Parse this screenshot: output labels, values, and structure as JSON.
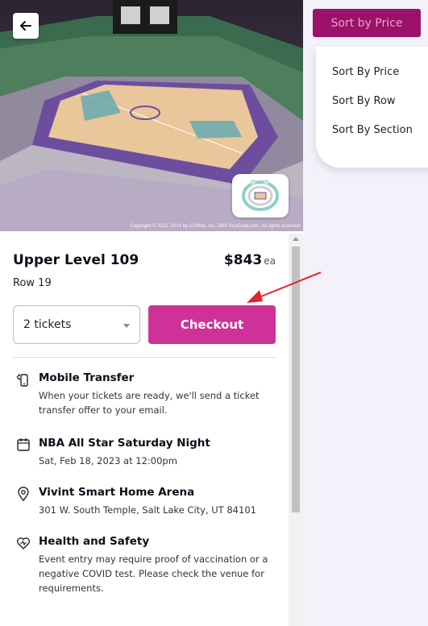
{
  "hero": {
    "back_icon": "arrow-left-icon",
    "map_icon": "seat-map-icon",
    "copyright": "Copyright © 2021. 2014 by G2Web, Inc. DBA SeatData.com. All rights reserved."
  },
  "listing": {
    "section": "Upper Level 109",
    "price": "$843",
    "price_unit": "ea",
    "row": "Row 19"
  },
  "purchase": {
    "ticket_quantity": "2 tickets",
    "checkout_label": "Checkout"
  },
  "info": [
    {
      "icon": "phone-transfer-icon",
      "title": "Mobile Transfer",
      "text": "When your tickets are ready, we'll send a ticket transfer offer to your email."
    },
    {
      "icon": "calendar-icon",
      "title": "NBA All Star Saturday Night",
      "text": "Sat, Feb 18, 2023 at 12:00pm"
    },
    {
      "icon": "location-pin-icon",
      "title": "Vivint Smart Home Arena",
      "text": "301 W. South Temple, Salt Lake City, UT 84101"
    },
    {
      "icon": "heart-health-icon",
      "title": "Health and Safety",
      "text": "Event entry may require proof of vaccination or a negative COVID test. Please check the venue for requirements."
    }
  ],
  "sort": {
    "button_label": "Sort by Price",
    "options": [
      "Sort By Price",
      "Sort By Row",
      "Sort By Section"
    ]
  },
  "colors": {
    "accent": "#ce3197",
    "sort_button": "#9c1169",
    "annotation_arrow": "#e8202a"
  }
}
